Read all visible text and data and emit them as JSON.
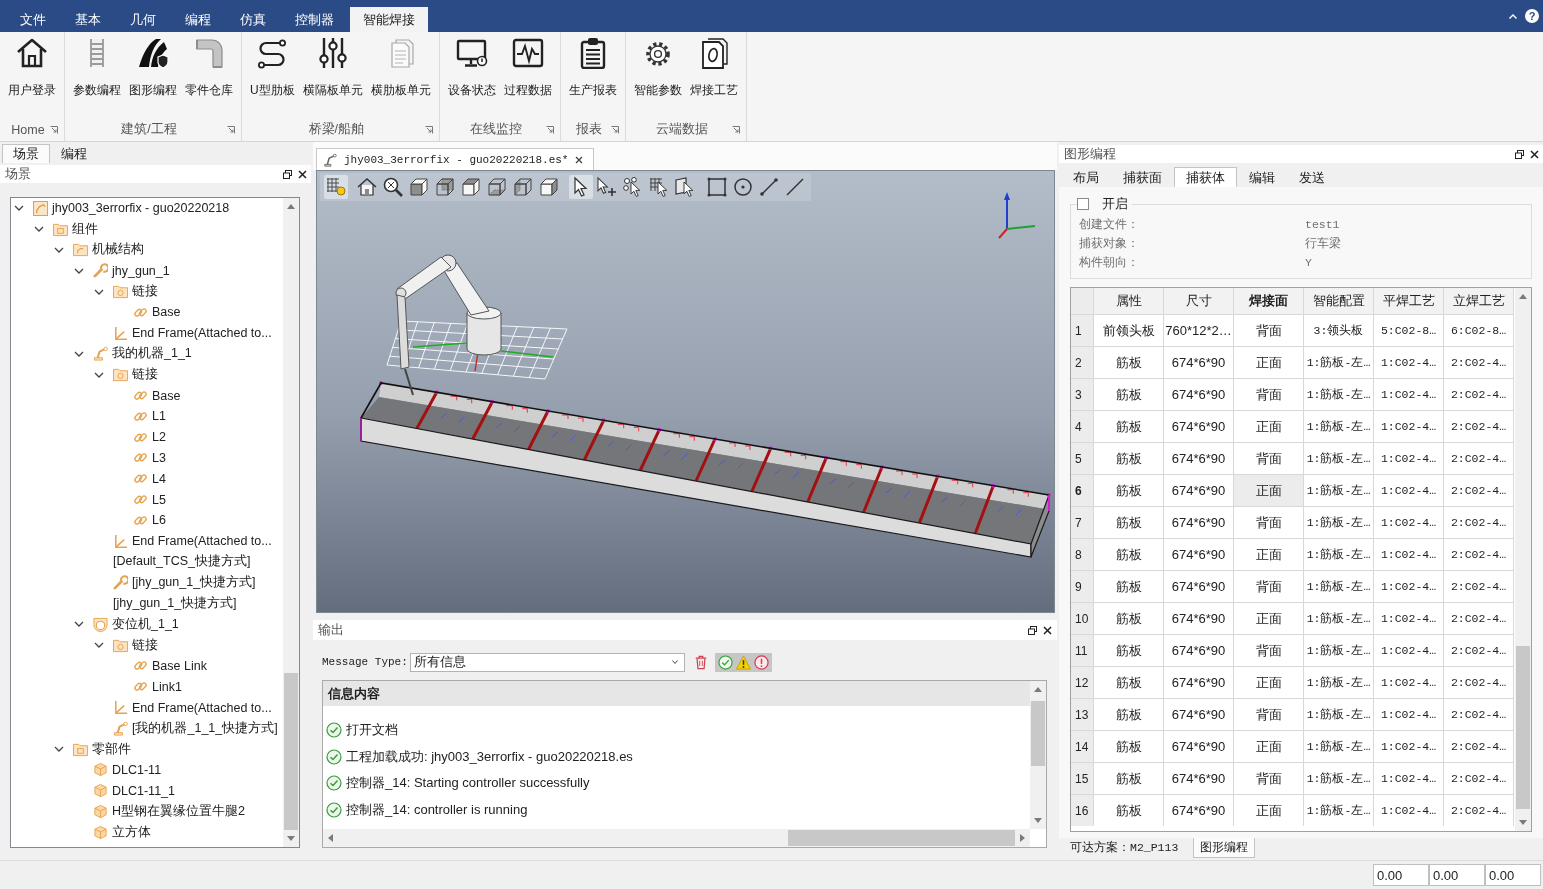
{
  "title_bar": {
    "tabs": [
      {
        "label": "文件",
        "selected": false
      },
      {
        "label": "基本",
        "selected": false
      },
      {
        "label": "几何",
        "selected": false
      },
      {
        "label": "编程",
        "selected": false
      },
      {
        "label": "仿真",
        "selected": false
      },
      {
        "label": "控制器",
        "selected": false
      },
      {
        "label": "智能焊接",
        "selected": true
      }
    ],
    "help": "?"
  },
  "ribbon": {
    "groups": [
      {
        "label": "Home",
        "buttons": [
          {
            "label": "用户登录",
            "kind": "home"
          }
        ]
      },
      {
        "label": "建筑/工程",
        "buttons": [
          {
            "label": "参数编程",
            "kind": "ladder"
          },
          {
            "label": "图形编程",
            "kind": "road"
          },
          {
            "label": "零件仓库",
            "kind": "pipe"
          }
        ]
      },
      {
        "label": "桥梁/船舶",
        "buttons": [
          {
            "label": "U型肋板",
            "kind": "path"
          },
          {
            "label": "横隔板单元",
            "kind": "sliders"
          },
          {
            "label": "横肋板单元",
            "kind": "pages"
          }
        ]
      },
      {
        "label": "在线监控",
        "buttons": [
          {
            "label": "设备状态",
            "kind": "monitor"
          },
          {
            "label": "过程数据",
            "kind": "wave"
          }
        ]
      },
      {
        "label": "报表",
        "buttons": [
          {
            "label": "生产报表",
            "kind": "clipboard"
          }
        ]
      },
      {
        "label": "云端数据",
        "buttons": [
          {
            "label": "智能参数",
            "kind": "gear"
          },
          {
            "label": "焊接工艺",
            "kind": "sheet"
          }
        ]
      }
    ]
  },
  "scene_panel": {
    "tabs": [
      {
        "label": "场景",
        "selected": true
      },
      {
        "label": "编程",
        "selected": false
      }
    ],
    "title": "场景",
    "tree": [
      {
        "label": "jhy003_3errorfix - guo20220218",
        "kind": "cell",
        "expanded": true,
        "children": [
          {
            "label": "组件",
            "kind": "folder",
            "expanded": true,
            "children": [
              {
                "label": "机械结构",
                "kind": "mechanism",
                "expanded": true,
                "children": [
                  {
                    "label": "jhy_gun_1",
                    "kind": "wrench",
                    "expanded": true,
                    "children": [
                      {
                        "label": "链接",
                        "kind": "links",
                        "expanded": true,
                        "children": [
                          {
                            "label": "Base",
                            "kind": "link"
                          }
                        ]
                      },
                      {
                        "label": "End Frame(Attached to...",
                        "kind": "frame"
                      }
                    ]
                  },
                  {
                    "label": "我的机器_1_1",
                    "kind": "robot",
                    "expanded": true,
                    "children": [
                      {
                        "label": "链接",
                        "kind": "links",
                        "expanded": true,
                        "children": [
                          {
                            "label": "Base",
                            "kind": "link"
                          },
                          {
                            "label": "L1",
                            "kind": "link"
                          },
                          {
                            "label": "L2",
                            "kind": "link"
                          },
                          {
                            "label": "L3",
                            "kind": "link"
                          },
                          {
                            "label": "L4",
                            "kind": "link"
                          },
                          {
                            "label": "L5",
                            "kind": "link"
                          },
                          {
                            "label": "L6",
                            "kind": "link"
                          }
                        ]
                      },
                      {
                        "label": "End Frame(Attached to...",
                        "kind": "frame"
                      },
                      {
                        "label": "[Default_TCS_快捷方式]",
                        "kind": "plain"
                      },
                      {
                        "label": "[jhy_gun_1_快捷方式]",
                        "kind": "wrench"
                      },
                      {
                        "label": "[jhy_gun_1_快捷方式]",
                        "kind": "plain"
                      }
                    ]
                  },
                  {
                    "label": "变位机_1_1",
                    "kind": "turntable",
                    "expanded": true,
                    "children": [
                      {
                        "label": "链接",
                        "kind": "links",
                        "expanded": true,
                        "children": [
                          {
                            "label": "Base Link",
                            "kind": "link"
                          },
                          {
                            "label": "Link1",
                            "kind": "link"
                          }
                        ]
                      },
                      {
                        "label": "End Frame(Attached to...",
                        "kind": "frame"
                      },
                      {
                        "label": "[我的机器_1_1_快捷方式]",
                        "kind": "robot"
                      }
                    ]
                  }
                ]
              },
              {
                "label": "零部件",
                "kind": "folder",
                "expanded": true,
                "children": [
                  {
                    "label": "DLC1-11",
                    "kind": "part"
                  },
                  {
                    "label": "DLC1-11_1",
                    "kind": "part"
                  },
                  {
                    "label": "H型钢在翼缘位置牛腿2",
                    "kind": "part"
                  },
                  {
                    "label": "立方体",
                    "kind": "part"
                  }
                ]
              }
            ]
          }
        ]
      }
    ]
  },
  "document": {
    "tab": "jhy003_3errorfix - guo20220218.es*",
    "toolbar": [
      {
        "kind": "grid-light",
        "on": true
      },
      {
        "kind": "home",
        "on": false
      },
      {
        "kind": "zoom-fit",
        "on": false
      },
      {
        "kind": "view-front",
        "on": false
      },
      {
        "kind": "view-back",
        "on": false
      },
      {
        "kind": "view-top",
        "on": false
      },
      {
        "kind": "view-bottom",
        "on": false
      },
      {
        "kind": "view-left",
        "on": false
      },
      {
        "kind": "view-right",
        "on": false
      },
      {
        "kind": "select",
        "on": true
      },
      {
        "kind": "select-add",
        "on": false
      },
      {
        "kind": "select-nodes",
        "on": false
      },
      {
        "kind": "select-grid",
        "on": false
      },
      {
        "kind": "select-face",
        "on": false
      },
      {
        "kind": "rectangle",
        "on": false
      },
      {
        "kind": "circle",
        "on": false
      },
      {
        "kind": "line-points",
        "on": false
      },
      {
        "kind": "line",
        "on": false
      }
    ]
  },
  "output_panel": {
    "title": "输出",
    "message_type": {
      "label": "Message Type:",
      "value": "所有信息"
    },
    "column": "信息内容",
    "messages": [
      {
        "kind": "success",
        "text": "打开文档"
      },
      {
        "kind": "success",
        "text": "工程加载成功: jhy003_3errorfix - guo20220218.es"
      },
      {
        "kind": "success",
        "text": "控制器_14: Starting controller successfully"
      },
      {
        "kind": "success",
        "text": "控制器_14: controller is running"
      }
    ]
  },
  "graphic_panel": {
    "title": "图形编程",
    "tabs": [
      {
        "label": "布局",
        "selected": false
      },
      {
        "label": "捕获面",
        "selected": false
      },
      {
        "label": "捕获体",
        "selected": true
      },
      {
        "label": "编辑",
        "selected": false
      },
      {
        "label": "发送",
        "selected": false
      }
    ],
    "capture": {
      "checkbox": {
        "label": "开启",
        "checked": false
      },
      "disabled": true,
      "fields": [
        {
          "label": "创建文件：",
          "value": "test1"
        },
        {
          "label": "捕获对象：",
          "value": "行车梁"
        },
        {
          "label": "构件朝向：",
          "value": "Y"
        }
      ]
    },
    "table": {
      "columns": [
        {
          "label": "属性",
          "selected": false
        },
        {
          "label": "尺寸",
          "selected": false
        },
        {
          "label": "焊接面",
          "selected": true
        },
        {
          "label": "智能配置",
          "selected": false
        },
        {
          "label": "平焊工艺",
          "selected": false
        },
        {
          "label": "立焊工艺",
          "selected": false
        }
      ],
      "rows": [
        {
          "number": "1",
          "selected": false,
          "cells": [
            "前领头板",
            "760*12*2…",
            "背面",
            "3:领头板",
            "5:C02-8…",
            "6:C02-8…"
          ]
        },
        {
          "number": "2",
          "selected": false,
          "cells": [
            "筋板",
            "674*6*90",
            "正面",
            "1:筋板-左…",
            "1:C02-4…",
            "2:C02-4…"
          ]
        },
        {
          "number": "3",
          "selected": false,
          "cells": [
            "筋板",
            "674*6*90",
            "背面",
            "1:筋板-左…",
            "1:C02-4…",
            "2:C02-4…"
          ]
        },
        {
          "number": "4",
          "selected": false,
          "cells": [
            "筋板",
            "674*6*90",
            "正面",
            "1:筋板-左…",
            "1:C02-4…",
            "2:C02-4…"
          ]
        },
        {
          "number": "5",
          "selected": false,
          "cells": [
            "筋板",
            "674*6*90",
            "背面",
            "1:筋板-左…",
            "1:C02-4…",
            "2:C02-4…"
          ]
        },
        {
          "number": "6",
          "selected": true,
          "cells": [
            "筋板",
            "674*6*90",
            "正面",
            "1:筋板-左…",
            "1:C02-4…",
            "2:C02-4…"
          ]
        },
        {
          "number": "7",
          "selected": false,
          "cells": [
            "筋板",
            "674*6*90",
            "背面",
            "1:筋板-左…",
            "1:C02-4…",
            "2:C02-4…"
          ]
        },
        {
          "number": "8",
          "selected": false,
          "cells": [
            "筋板",
            "674*6*90",
            "正面",
            "1:筋板-左…",
            "1:C02-4…",
            "2:C02-4…"
          ]
        },
        {
          "number": "9",
          "selected": false,
          "cells": [
            "筋板",
            "674*6*90",
            "背面",
            "1:筋板-左…",
            "1:C02-4…",
            "2:C02-4…"
          ]
        },
        {
          "number": "10",
          "selected": false,
          "cells": [
            "筋板",
            "674*6*90",
            "正面",
            "1:筋板-左…",
            "1:C02-4…",
            "2:C02-4…"
          ]
        },
        {
          "number": "11",
          "selected": false,
          "cells": [
            "筋板",
            "674*6*90",
            "背面",
            "1:筋板-左…",
            "1:C02-4…",
            "2:C02-4…"
          ]
        },
        {
          "number": "12",
          "selected": false,
          "cells": [
            "筋板",
            "674*6*90",
            "正面",
            "1:筋板-左…",
            "1:C02-4…",
            "2:C02-4…"
          ]
        },
        {
          "number": "13",
          "selected": false,
          "cells": [
            "筋板",
            "674*6*90",
            "背面",
            "1:筋板-左…",
            "1:C02-4…",
            "2:C02-4…"
          ]
        },
        {
          "number": "14",
          "selected": false,
          "cells": [
            "筋板",
            "674*6*90",
            "正面",
            "1:筋板-左…",
            "1:C02-4…",
            "2:C02-4…"
          ]
        },
        {
          "number": "15",
          "selected": false,
          "cells": [
            "筋板",
            "674*6*90",
            "背面",
            "1:筋板-左…",
            "1:C02-4…",
            "2:C02-4…"
          ]
        },
        {
          "number": "16",
          "selected": false,
          "cells": [
            "筋板",
            "674*6*90",
            "正面",
            "1:筋板-左…",
            "1:C02-4…",
            "2:C02-4…"
          ]
        }
      ]
    },
    "bottom_tabs": [
      {
        "label": "可达方案：M2_P113",
        "selected": false
      },
      {
        "label": "图形编程",
        "selected": true
      }
    ]
  },
  "status_bar": {
    "fields": [
      "0.00",
      "0.00",
      "0.00"
    ]
  }
}
